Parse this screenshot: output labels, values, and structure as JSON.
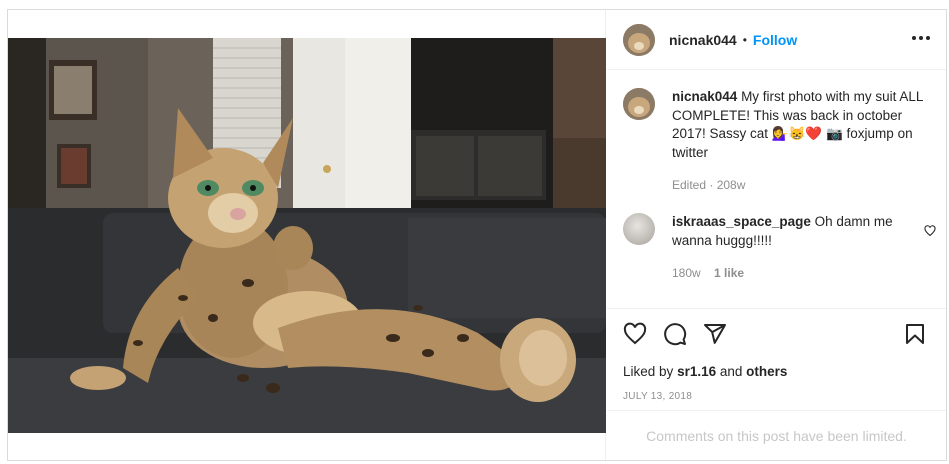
{
  "post": {
    "username": "nicnak044",
    "follow_label": "Follow",
    "separator": "•",
    "caption_user": "nicnak044",
    "caption_text": "My first photo with my suit ALL COMPLETE! This was back in october 2017! Sassy cat 💁‍♀️😸❤️ 📷 foxjump on twitter",
    "caption_meta": "Edited · 208w",
    "photo_alt_icon": "furry-lynx-costume-photo",
    "likes_prefix": "Liked by",
    "likes_user": "sr1.16",
    "likes_and": "and",
    "likes_others": "others",
    "date": "JULY 13, 2018",
    "comments_limited": "Comments on this post have been limited."
  },
  "comment": {
    "username": "iskraaas_space_page",
    "text": "Oh damn me wanna huggg!!!!!",
    "age": "180w",
    "likes": "1 like"
  },
  "icons": {
    "more": "more-options-icon",
    "heart": "heart-icon",
    "comment": "comment-icon",
    "share": "share-icon",
    "save": "bookmark-icon"
  },
  "colors": {
    "accent": "#0095f6",
    "text": "#262626",
    "muted": "#8e8e8e",
    "disabled": "#c7c7c7",
    "border": "#dbdbdb"
  }
}
